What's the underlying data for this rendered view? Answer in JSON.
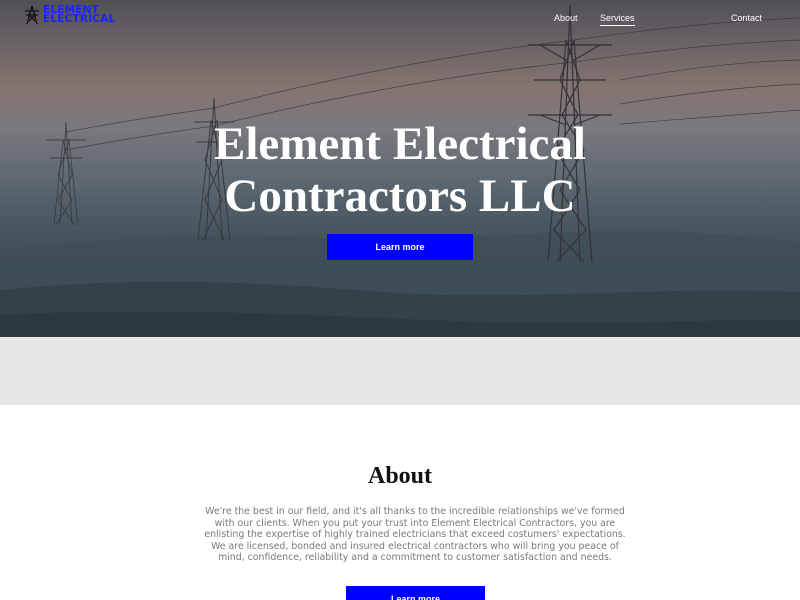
{
  "brand": {
    "name_line1": "ELEMENT",
    "name_line2": "ELECTRICAL",
    "logo_icon": "power-tower-icon",
    "color": "#1a22ff"
  },
  "nav": {
    "items": [
      {
        "label": "About"
      },
      {
        "label": "Services",
        "active": true
      },
      {
        "label": "Contact"
      }
    ]
  },
  "hero": {
    "title_line1": "Element Electrical",
    "title_line2": "Contractors LLC",
    "button_label": "Learn more",
    "button_color": "#0000ff"
  },
  "about": {
    "heading": "About",
    "body": "We're the best in our field, and it's all thanks to the incredible relationships we've formed with our clients. When you put your trust into Element Electrical Contractors, you are enlisting the expertise of highly trained electricians that exceed costumers' expectations. We are licensed, bonded and insured electrical contractors who will bring you peace of mind, confidence, reliability and a commitment to customer satisfaction and needs.",
    "button_label": "Learn more"
  }
}
